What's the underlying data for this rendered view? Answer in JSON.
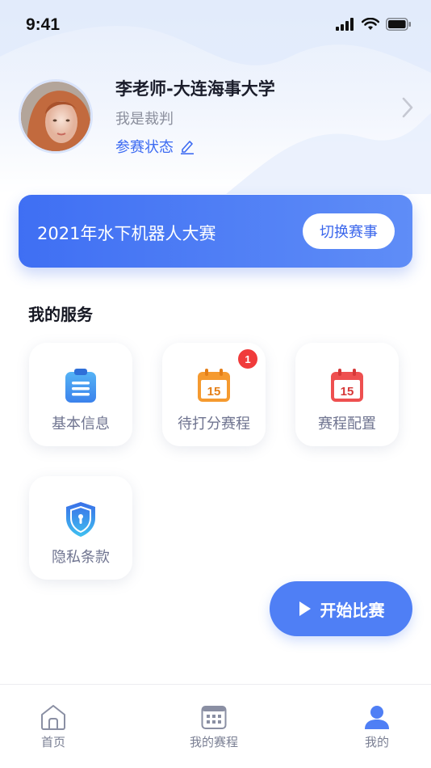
{
  "status_bar": {
    "time": "9:41"
  },
  "profile": {
    "name": "李老师-大连海事大学",
    "role": "我是裁判",
    "status_link": "参赛状态"
  },
  "event": {
    "title": "2021年水下机器人大赛",
    "switch_label": "切换赛事"
  },
  "services": {
    "section_title": "我的服务",
    "items": [
      {
        "label": "基本信息",
        "icon": "clipboard-icon"
      },
      {
        "label": "待打分赛程",
        "icon": "calendar-icon",
        "badge": "1",
        "date": "15"
      },
      {
        "label": "赛程配置",
        "icon": "calendar-icon",
        "date": "15"
      },
      {
        "label": "隐私条款",
        "icon": "shield-lock-icon"
      }
    ]
  },
  "start_button": {
    "label": "开始比赛"
  },
  "tabbar": {
    "items": [
      {
        "label": "首页",
        "icon": "home-icon",
        "active": false
      },
      {
        "label": "我的赛程",
        "icon": "calendar-grid-icon",
        "active": false
      },
      {
        "label": "我的",
        "icon": "user-icon",
        "active": true
      }
    ]
  },
  "colors": {
    "accent": "#4f7ff5",
    "banner_start": "#3f6ff3",
    "badge": "#f03b3b",
    "calendar_orange": "#f59a2f",
    "calendar_red": "#ee5050"
  }
}
